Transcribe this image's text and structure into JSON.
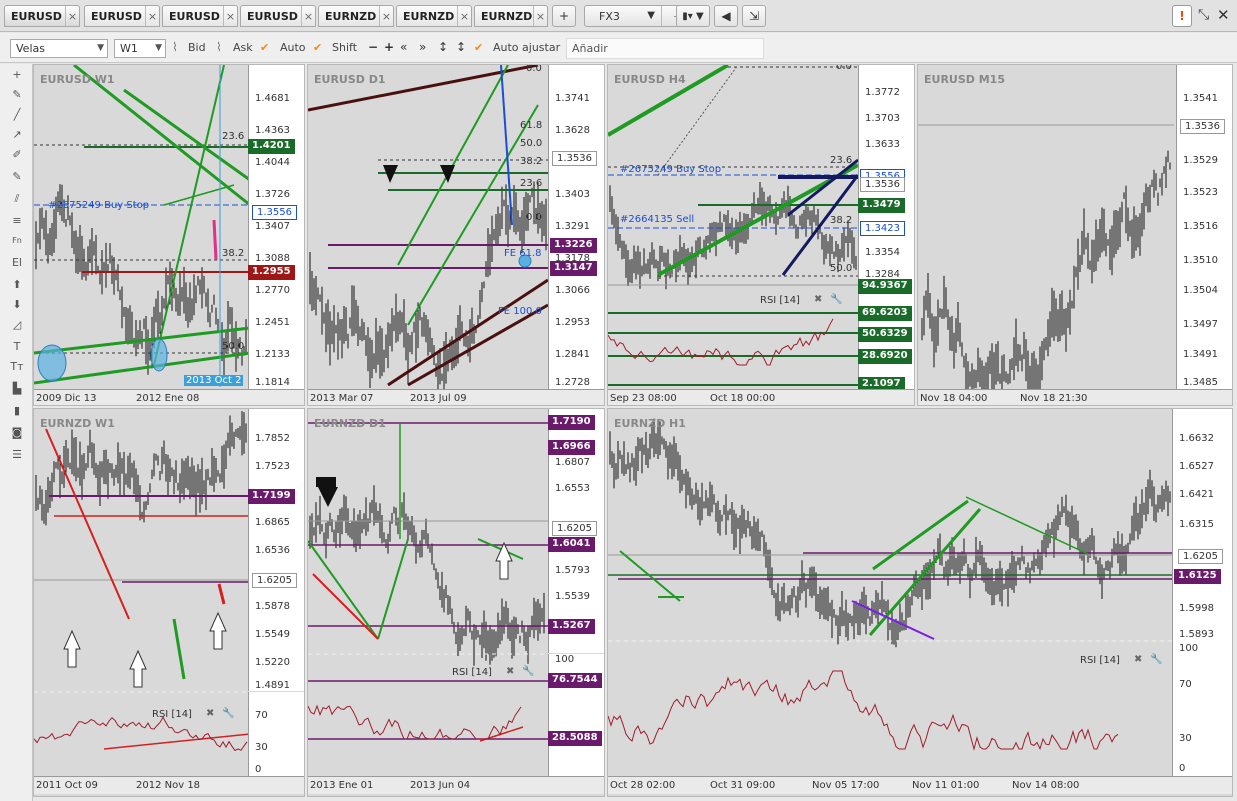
{
  "tabs": [
    {
      "label": "EURUSD",
      "active": true
    },
    {
      "label": "EURUSD",
      "active": false
    },
    {
      "label": "EURUSD",
      "active": false
    },
    {
      "label": "EURUSD",
      "active": false
    },
    {
      "label": "EURNZD",
      "active": false
    },
    {
      "label": "EURNZD",
      "active": false
    },
    {
      "label": "EURNZD",
      "active": false
    }
  ],
  "workspace": {
    "selected": "FX3"
  },
  "toolbar": {
    "chart_type": "Velas",
    "period": "W1",
    "bid_label": "Bid",
    "ask_label": "Ask",
    "auto_label": "Auto",
    "shift_label": "Shift",
    "auto_adjust_label": "Auto ajustar",
    "add_placeholder": "Añadir"
  },
  "colors": {
    "green_line": "#1f9a22",
    "dark_green_tag": "#1a6b2a",
    "red_tag": "#9e1616",
    "purple_tag": "#6a1a6a",
    "blue_order": "#1a4fd1",
    "candle": "#111111",
    "rsi_line": "#9e1d2d"
  },
  "panels": {
    "eurusd_w1": {
      "title": "EURUSD W1",
      "yticks": [
        "1.4681",
        "1.4363",
        "1.4044",
        "1.3726",
        "1.3407",
        "1.3088",
        "1.2770",
        "1.2451",
        "1.2133",
        "1.1814"
      ],
      "xticks": [
        "2009 Dic 13",
        "2012 Ene 08"
      ],
      "tag_green": "1.4201",
      "tag_current": "1.3556",
      "tag_red": "1.2955",
      "order_label": "#2675249 Buy Stop",
      "fib_236": "23.6",
      "fib_382": "38.2",
      "fib_500": "50.0",
      "date_marker": "2013 Oct 2"
    },
    "eurusd_d1": {
      "title": "EURUSD D1",
      "yticks": [
        "1.3741",
        "1.3628",
        "1.3516",
        "1.3403",
        "1.3291",
        "1.3178",
        "1.3066",
        "1.2953",
        "1.2841",
        "1.2728"
      ],
      "xticks": [
        "2013 Mar 07",
        "2013 Jul 09"
      ],
      "tag_current": "1.3536",
      "tag_purple_1": "1.3226",
      "tag_purple_2": "1.3147",
      "fib_618": "61.8",
      "fib_500": "50.0",
      "fib_382": "38.2",
      "fib_236": "23.6",
      "fib_000": "0.0",
      "fib_top": "0.0",
      "fe_618": "FE 61.8",
      "fe_1000": "FE 100.0"
    },
    "eurusd_h4": {
      "title": "EURUSD H4",
      "yticks": [
        "1.3772",
        "1.3703",
        "1.3633",
        "1.3354",
        "1.3284"
      ],
      "xticks": [
        "Sep 23 08:00",
        "Oct 18 00:00"
      ],
      "tag_blue": "1.3556",
      "tag_current": "1.3536",
      "tag_green_1": "1.3479",
      "tag_blue_2": "1.3423",
      "order_label_1": "#2675249 Buy Stop",
      "order_label_2": "#2664135 Sell",
      "fib_236": "23.6",
      "fib_382": "38.2",
      "fib_500": "50.0",
      "fib_top": "0.0",
      "rsi_label": "RSI [14]",
      "rsi_tags": [
        "94.9367",
        "69.6203",
        "50.6329",
        "28.6920",
        "2.1097"
      ]
    },
    "eurusd_m15": {
      "title": "EURUSD M15",
      "yticks": [
        "1.3541",
        "1.3529",
        "1.3523",
        "1.3516",
        "1.3510",
        "1.3504",
        "1.3497",
        "1.3491",
        "1.3485"
      ],
      "xticks": [
        "Nov 18 04:00",
        "Nov 18 21:30"
      ],
      "tag_current": "1.3536"
    },
    "eurnzd_w1": {
      "title": "EURNZD W1",
      "yticks": [
        "1.7852",
        "1.7523",
        "1.6865",
        "1.6536",
        "1.5878",
        "1.5549",
        "1.5220",
        "1.4891"
      ],
      "xticks": [
        "2011 Oct 09",
        "2012 Nov 18"
      ],
      "tag_purple": "1.7199",
      "tag_current": "1.6205",
      "rsi_label": "RSI [14]",
      "rsi_ticks": [
        "70",
        "30",
        "0"
      ]
    },
    "eurnzd_d1": {
      "title": "EURNZD D1",
      "yticks": [
        "1.6807",
        "1.6553",
        "1.5793",
        "1.5539"
      ],
      "xticks": [
        "2013 Ene 01",
        "2013 Jun 04"
      ],
      "tag_top": "1.7190",
      "tag_2": "1.6966",
      "tag_current": "1.6205",
      "tag_3": "1.6041",
      "tag_4": "1.5267",
      "rsi_label": "RSI [14]",
      "rsi_ticks": [
        "100"
      ],
      "rsi_tag_high": "76.7544",
      "rsi_tag_low": "28.5088"
    },
    "eurnzd_h1": {
      "title": "EURNZD H1",
      "yticks": [
        "1.6632",
        "1.6527",
        "1.6421",
        "1.6315",
        "1.5998",
        "1.5893"
      ],
      "xticks": [
        "Oct 28 02:00",
        "Oct 31 09:00",
        "Nov 05 17:00",
        "Nov 11 01:00",
        "Nov 14 08:00"
      ],
      "tag_current": "1.6205",
      "tag_purple": "1.6125",
      "rsi_label": "RSI [14]",
      "rsi_ticks": [
        "100",
        "70",
        "30",
        "0"
      ]
    }
  }
}
